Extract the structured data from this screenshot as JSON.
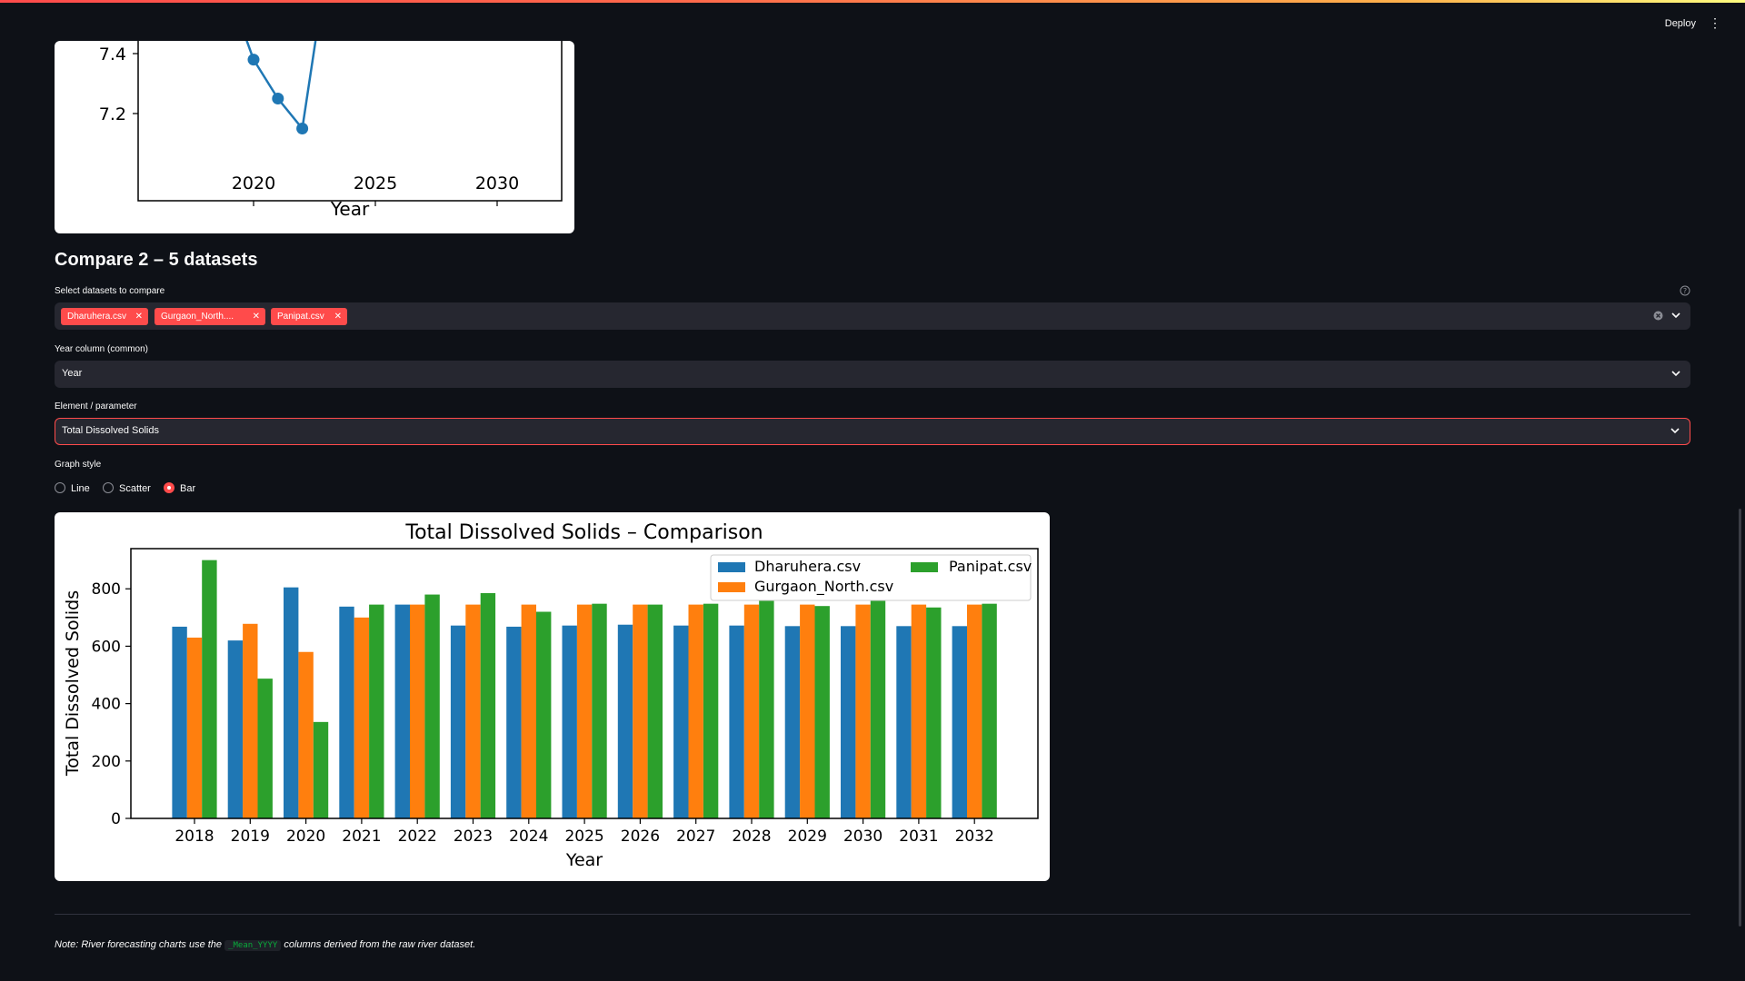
{
  "header": {
    "deploy_label": "Deploy",
    "menu_icon": "more-vertical-icon"
  },
  "compare": {
    "title": "Compare 2 – 5 datasets",
    "datasets_label": "Select datasets to compare",
    "selected": [
      "Dharuhera.csv",
      "Gurgaon_North....",
      "Panipat.csv"
    ],
    "year_label": "Year column (common)",
    "year_value": "Year",
    "element_label": "Element / parameter",
    "element_value": "Total Dissolved Solids",
    "graph_style_label": "Graph style",
    "graph_styles": [
      "Line",
      "Scatter",
      "Bar"
    ],
    "graph_style_selected": "Bar"
  },
  "note": {
    "prefix": "Note: River forecasting charts use the",
    "code": "_Mean_YYYY",
    "suffix": "columns derived from the raw river dataset."
  },
  "colors": {
    "accent": "#ff4b4b",
    "blue": "#1f77b4",
    "orange": "#ff7f0e",
    "green": "#2ca02c"
  },
  "chart_data": [
    {
      "type": "line",
      "title": "",
      "xlabel": "Year",
      "ylabel": "",
      "x_ticks": [
        "2020",
        "2025",
        "2030"
      ],
      "y_ticks": [
        "7.2",
        "7.4"
      ],
      "series": [
        {
          "x": [
            2020,
            2021,
            2022
          ],
          "y": [
            7.38,
            7.25,
            7.15
          ]
        }
      ],
      "note": "partially visible line continues upward after 2022"
    },
    {
      "type": "bar",
      "title": "Total Dissolved Solids – Comparison",
      "xlabel": "Year",
      "ylabel": "Total Dissolved Solids",
      "ylim": [
        0,
        940
      ],
      "y_ticks": [
        0,
        200,
        400,
        600,
        800
      ],
      "legend_position": "top-right",
      "categories": [
        "2018",
        "2019",
        "2020",
        "2021",
        "2022",
        "2023",
        "2024",
        "2025",
        "2026",
        "2027",
        "2028",
        "2029",
        "2030",
        "2031",
        "2032"
      ],
      "series": [
        {
          "name": "Dharuhera.csv",
          "color": "#1f77b4",
          "values": [
            668,
            620,
            805,
            738,
            745,
            672,
            668,
            672,
            675,
            672,
            672,
            670,
            670,
            670,
            670
          ]
        },
        {
          "name": "Gurgaon_North.csv",
          "color": "#ff7f0e",
          "values": [
            630,
            678,
            580,
            700,
            745,
            745,
            745,
            745,
            745,
            745,
            745,
            745,
            745,
            745,
            745
          ]
        },
        {
          "name": "Panipat.csv",
          "color": "#2ca02c",
          "values": [
            900,
            487,
            336,
            745,
            780,
            785,
            720,
            748,
            745,
            748,
            762,
            740,
            762,
            735,
            748
          ]
        }
      ]
    }
  ]
}
